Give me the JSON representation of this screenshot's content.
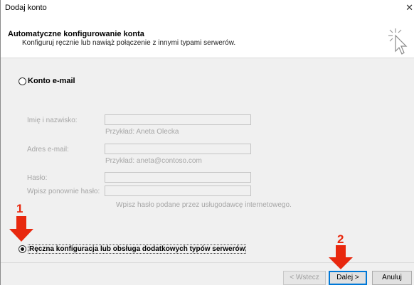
{
  "window": {
    "title": "Dodaj konto",
    "close_glyph": "✕"
  },
  "header": {
    "title": "Automatyczne konfigurowanie konta",
    "subtitle": "Konfiguruj ręcznie lub nawiąż połączenie z innymi typami serwerów.",
    "icon": "wizard-cursor-icon"
  },
  "email_option": {
    "label": "Konto e-mail",
    "selected": false
  },
  "fields": {
    "name_label": "Imię i nazwisko:",
    "name_value": "",
    "name_hint": "Przykład: Aneta Olecka",
    "email_label": "Adres e-mail:",
    "email_value": "",
    "email_hint": "Przykład: aneta@contoso.com",
    "password_label": "Hasło:",
    "password_value": "",
    "password_retype_label": "Wpisz ponownie hasło:",
    "password_retype_value": "",
    "password_hint": "Wpisz hasło podane przez usługodawcę internetowego."
  },
  "manual_option": {
    "label": "Ręczna konfiguracja lub obsługa dodatkowych typów serwerów",
    "selected": true
  },
  "buttons": {
    "back": "< Wstecz",
    "next": "Dalej >",
    "cancel": "Anuluj"
  },
  "annotations": {
    "step1": "1",
    "step2": "2",
    "arrow_color": "#e8280e"
  }
}
